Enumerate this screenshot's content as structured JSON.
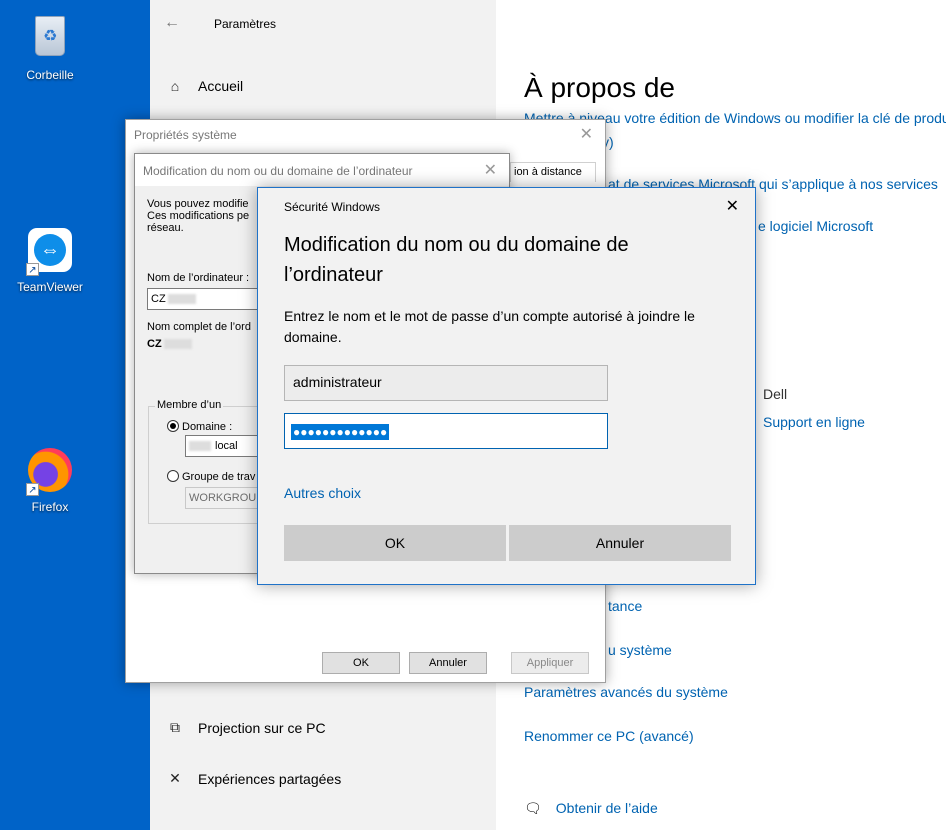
{
  "desktop": {
    "icons": [
      {
        "label": "Corbeille"
      },
      {
        "label": "TeamViewer"
      },
      {
        "label": "Firefox"
      }
    ]
  },
  "settings": {
    "app_title": "Paramètres",
    "nav": {
      "home": "Accueil",
      "projection": "Projection sur ce PC",
      "shared": "Expériences partagées"
    },
    "page_title": "À propos de",
    "links": {
      "upgrade": "Mettre à niveau votre édition de Windows ou modifier la clé de produit",
      "upgrade_tail": "y)",
      "services": "at de services Microsoft qui s’applique à nos services",
      "software": "e logiciel Microsoft",
      "support": "Support en ligne",
      "remote": "tance",
      "protection": "u système",
      "advanced": "Paramètres avancés du système",
      "rename": "Renommer ce PC (avancé)",
      "help": "Obtenir de l’aide"
    },
    "manufacturer": "Dell"
  },
  "sysprops": {
    "title": "Propriétés système",
    "tab_remote": "ion à distance",
    "ok": "OK",
    "cancel": "Annuler",
    "apply": "Appliquer"
  },
  "cname": {
    "title": "Modification du nom ou du domaine de l’ordinateur",
    "intro_1": "Vous pouvez modifie",
    "intro_2": "Ces modifications pe",
    "intro_3": "réseau.",
    "name_label": "Nom de l’ordinateur :",
    "name_value": "CZ",
    "full_label": "Nom complet de l’ord",
    "full_value": "CZ",
    "member_legend": "Membre d’un",
    "domain_label": "Domaine :",
    "domain_value": "local",
    "workgroup_label": "Groupe de trav",
    "workgroup_value": "WORKGROU"
  },
  "security": {
    "title": "Sécurité Windows",
    "heading": "Modification du nom ou du domaine de l’ordinateur",
    "description": "Entrez le nom et le mot de passe d’un compte autorisé à joindre le domaine.",
    "username": "administrateur",
    "password_mask": "●●●●●●●●●●●●●",
    "other_choices": "Autres choix",
    "ok": "OK",
    "cancel": "Annuler"
  },
  "icons": {
    "back": "back-arrow-icon",
    "close": "close-icon",
    "home": "home-icon",
    "projection": "projection-icon",
    "shared": "shared-experiences-icon",
    "help": "help-chat-icon"
  }
}
